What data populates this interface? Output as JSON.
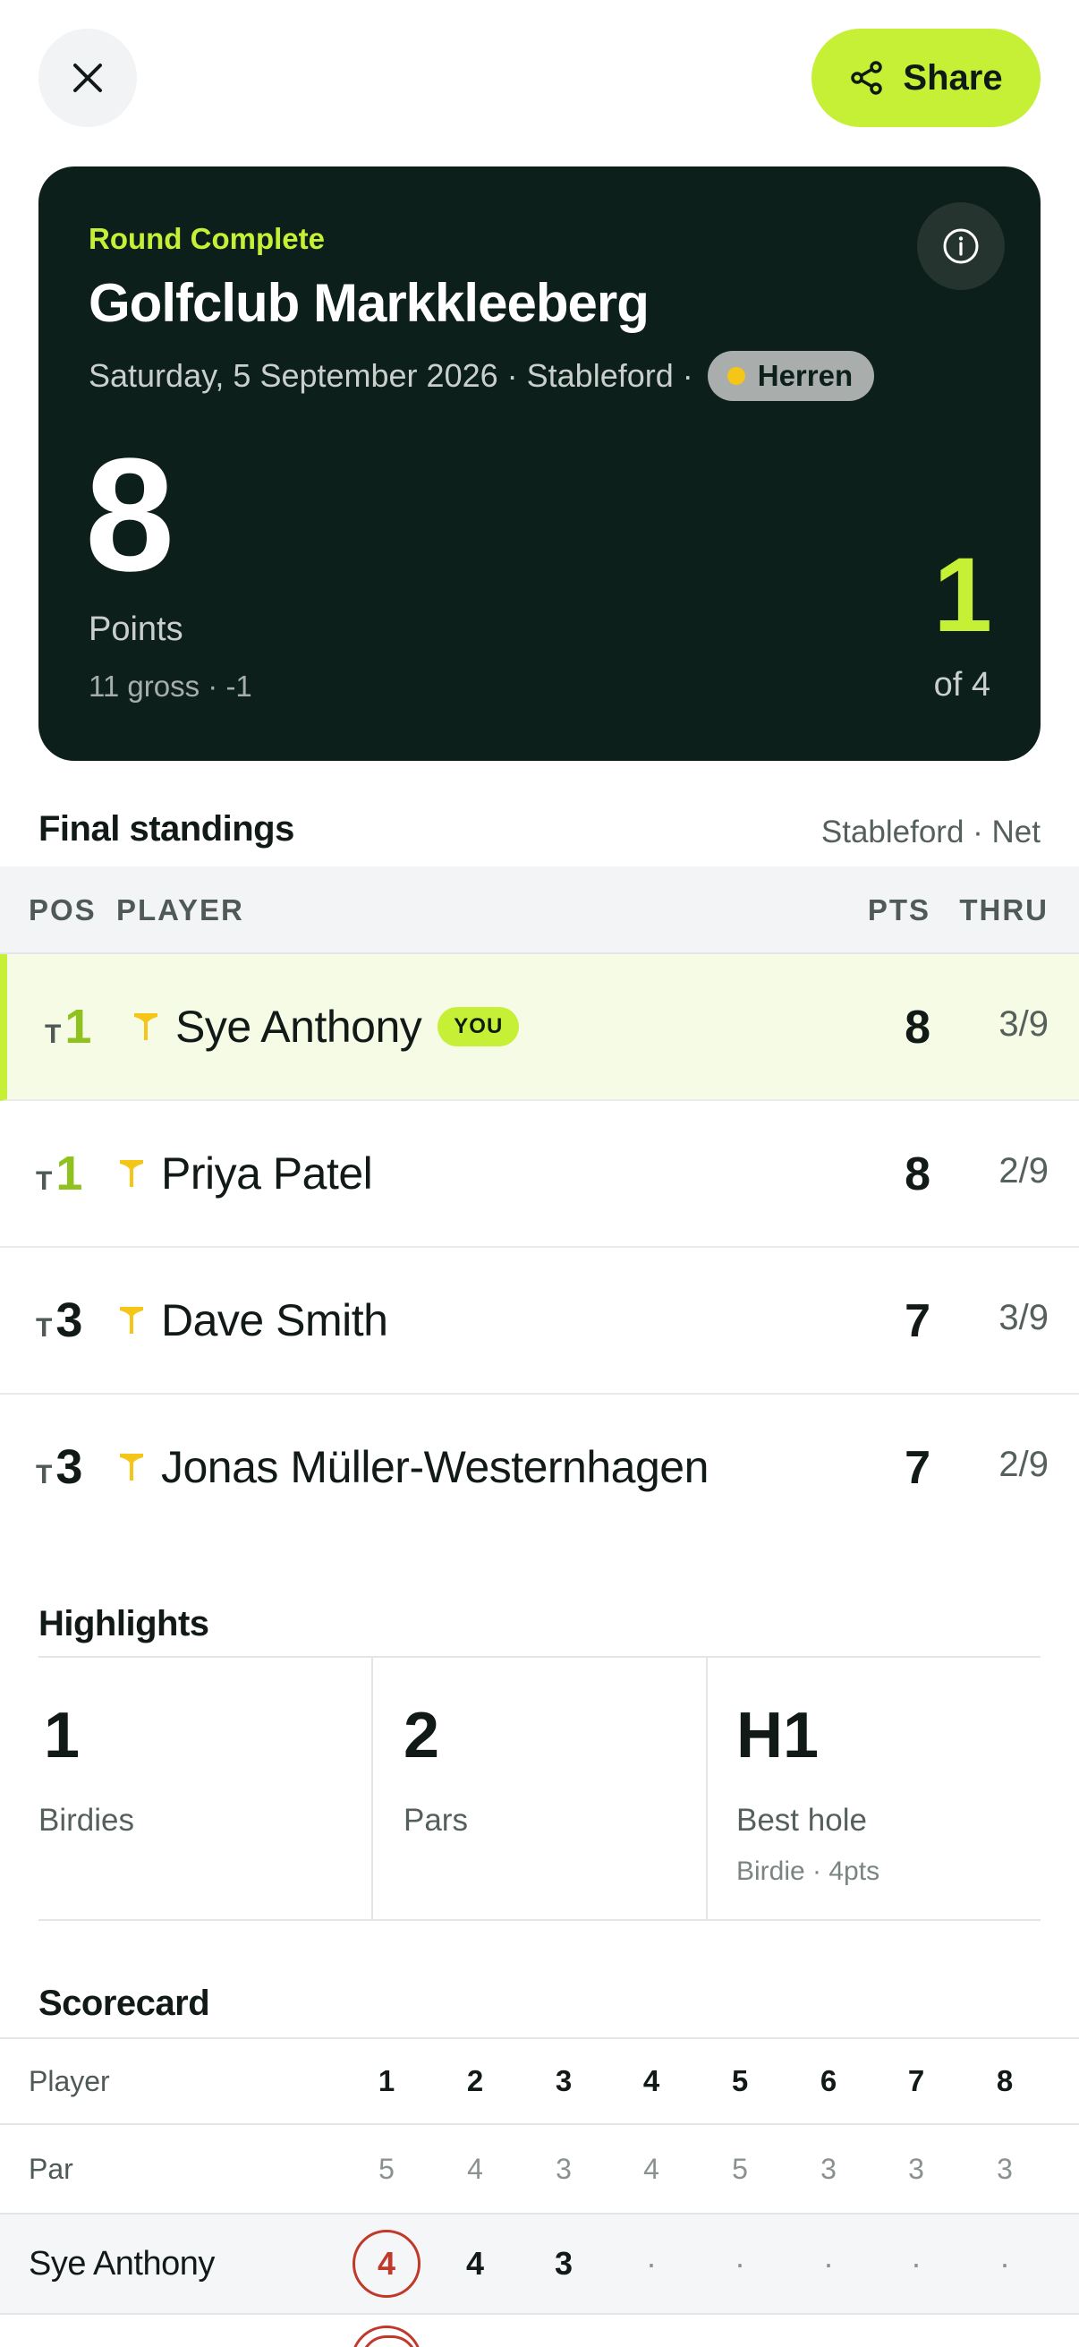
{
  "topbar": {
    "close_icon": "close-icon",
    "share_label": "Share",
    "share_icon": "share-icon"
  },
  "hero": {
    "status": "Round Complete",
    "course": "Golfclub Markkleeberg",
    "date": "Saturday, 5 September 2026",
    "format": "Stableford",
    "tee": "Herren",
    "tee_color": "#f5c518",
    "points": "8",
    "points_label": "Points",
    "points_sub": "11 gross · -1",
    "rank": "1",
    "rank_of": "of 4",
    "accent": "#c6f035",
    "card_bg": "#0d1f1b"
  },
  "standings": {
    "title": "Final standings",
    "subtitle": "Stableford · Net",
    "columns": {
      "pos": "POS",
      "player": "PLAYER",
      "pts": "PTS",
      "thru": "THRU"
    },
    "you_badge": "YOU",
    "rows": [
      {
        "tie": "T",
        "pos": "1",
        "name": "Sye Anthony",
        "pts": "8",
        "thru": "3/9",
        "me": true
      },
      {
        "tie": "T",
        "pos": "1",
        "name": "Priya Patel",
        "pts": "8",
        "thru": "2/9",
        "me": false
      },
      {
        "tie": "T",
        "pos": "3",
        "name": "Dave Smith",
        "pts": "7",
        "thru": "3/9",
        "me": false
      },
      {
        "tie": "T",
        "pos": "3",
        "name": "Jonas Müller-Westernhagen",
        "pts": "7",
        "thru": "2/9",
        "me": false
      }
    ]
  },
  "highlights": {
    "title": "Highlights",
    "items": [
      {
        "value": "1",
        "label": "Birdies",
        "sub": ""
      },
      {
        "value": "2",
        "label": "Pars",
        "sub": ""
      },
      {
        "value": "H1",
        "label": "Best hole",
        "sub": "Birdie · 4pts"
      }
    ]
  },
  "scorecard": {
    "title": "Scorecard",
    "player_header": "Player",
    "par_label": "Par",
    "holes": [
      "1",
      "2",
      "3",
      "4",
      "5",
      "6",
      "7",
      "8"
    ],
    "par": [
      "5",
      "4",
      "3",
      "4",
      "5",
      "3",
      "3",
      "3"
    ],
    "players": [
      {
        "name": "Sye Anthony",
        "scores": [
          "4",
          "4",
          "3",
          "·",
          "·",
          "·",
          "·",
          "·"
        ]
      }
    ]
  }
}
